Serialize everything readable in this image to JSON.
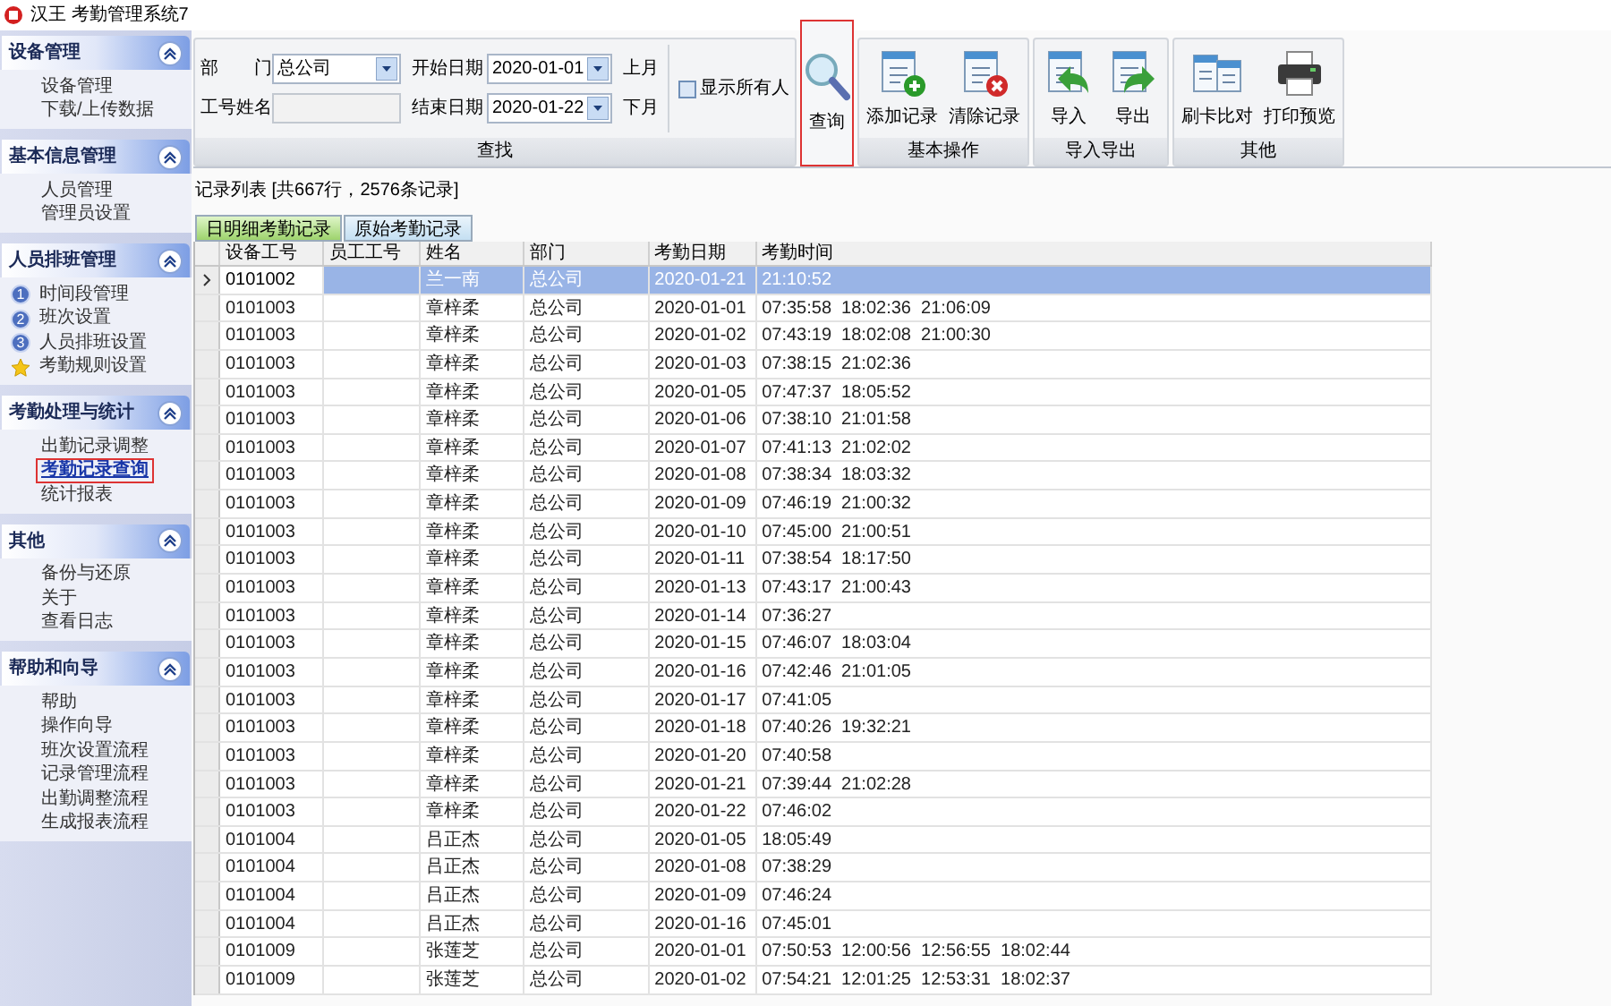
{
  "window": {
    "title": "汉王 考勤管理系统7"
  },
  "sidebar": [
    {
      "title": "设备管理",
      "expanded": true,
      "items": [
        {
          "label": "设备管理",
          "selected": false
        },
        {
          "label": "下载/上传数据",
          "selected": false
        }
      ]
    },
    {
      "title": "基本信息管理",
      "expanded": true,
      "items": [
        {
          "label": "人员管理",
          "selected": false
        },
        {
          "label": "管理员设置",
          "selected": false
        }
      ]
    },
    {
      "title": "人员排班管理",
      "expanded": true,
      "items": [
        {
          "label": "时间段管理",
          "selected": false,
          "kind": "numbered",
          "badge": "1"
        },
        {
          "label": "班次设置",
          "selected": false,
          "kind": "numbered",
          "badge": "2"
        },
        {
          "label": "人员排班设置",
          "selected": false,
          "kind": "numbered",
          "badge": "3"
        },
        {
          "label": "考勤规则设置",
          "selected": false,
          "kind": "star"
        }
      ]
    },
    {
      "title": "考勤处理与统计",
      "expanded": true,
      "items": [
        {
          "label": "出勤记录调整",
          "selected": false
        },
        {
          "label": "考勤记录查询",
          "selected": true
        },
        {
          "label": "统计报表",
          "selected": false
        }
      ]
    },
    {
      "title": "其他",
      "expanded": true,
      "items": [
        {
          "label": "备份与还原",
          "selected": false
        },
        {
          "label": "关于",
          "selected": false
        },
        {
          "label": "查看日志",
          "selected": false
        }
      ]
    },
    {
      "title": "帮助和向导",
      "expanded": true,
      "items": [
        {
          "label": "帮助",
          "selected": false
        },
        {
          "label": "操作向导",
          "selected": false
        },
        {
          "label": "班次设置流程",
          "selected": false
        },
        {
          "label": "记录管理流程",
          "selected": false
        },
        {
          "label": "出勤调整流程",
          "selected": false
        },
        {
          "label": "生成报表流程",
          "selected": false
        }
      ]
    }
  ],
  "filter": {
    "department_label": "部　　门",
    "department": "总公司",
    "id_name_label": "工号姓名",
    "start_label": "开始日期",
    "start_date": "2020-01-01",
    "end_label": "结束日期",
    "end_date": "2020-01-22",
    "prev_month": "上月",
    "next_month": "下月",
    "show_all": {
      "label": "显示所有人",
      "checked": false
    },
    "group_label": "查找"
  },
  "query_button": {
    "label": "查询",
    "highlighted": true
  },
  "toolbar_groups": [
    {
      "label": "基本操作",
      "buttons": [
        {
          "label": "添加记录",
          "kind": "add"
        },
        {
          "label": "清除记录",
          "kind": "delete"
        }
      ]
    },
    {
      "label": "导入导出",
      "buttons": [
        {
          "label": "导入",
          "kind": "import"
        },
        {
          "label": "导出",
          "kind": "export"
        }
      ]
    },
    {
      "label": "其他",
      "buttons": [
        {
          "label": "刷卡比对",
          "kind": "compare"
        },
        {
          "label": "打印预览",
          "kind": "print"
        }
      ]
    }
  ],
  "record_summary": "记录列表 [共667行，2576条记录]",
  "tabs": [
    {
      "label": "日明细考勤记录",
      "selected": true
    },
    {
      "label": "原始考勤记录",
      "selected": false
    }
  ],
  "table": {
    "columns": [
      "设备工号",
      "员工工号",
      "姓名",
      "部门",
      "考勤日期",
      "考勤时间"
    ],
    "rows": [
      {
        "device_id": "0101002",
        "employee_id": "",
        "name": "兰一南",
        "department": "总公司",
        "date": "2020-01-21",
        "times": "21:10:52",
        "selected": true
      },
      {
        "device_id": "0101003",
        "employee_id": "",
        "name": "章梓柔",
        "department": "总公司",
        "date": "2020-01-01",
        "times": "07:35:58  18:02:36  21:06:09",
        "selected": false
      },
      {
        "device_id": "0101003",
        "employee_id": "",
        "name": "章梓柔",
        "department": "总公司",
        "date": "2020-01-02",
        "times": "07:43:19  18:02:08  21:00:30",
        "selected": false
      },
      {
        "device_id": "0101003",
        "employee_id": "",
        "name": "章梓柔",
        "department": "总公司",
        "date": "2020-01-03",
        "times": "07:38:15  21:02:36",
        "selected": false
      },
      {
        "device_id": "0101003",
        "employee_id": "",
        "name": "章梓柔",
        "department": "总公司",
        "date": "2020-01-05",
        "times": "07:47:37  18:05:52",
        "selected": false
      },
      {
        "device_id": "0101003",
        "employee_id": "",
        "name": "章梓柔",
        "department": "总公司",
        "date": "2020-01-06",
        "times": "07:38:10  21:01:58",
        "selected": false
      },
      {
        "device_id": "0101003",
        "employee_id": "",
        "name": "章梓柔",
        "department": "总公司",
        "date": "2020-01-07",
        "times": "07:41:13  21:02:02",
        "selected": false
      },
      {
        "device_id": "0101003",
        "employee_id": "",
        "name": "章梓柔",
        "department": "总公司",
        "date": "2020-01-08",
        "times": "07:38:34  18:03:32",
        "selected": false
      },
      {
        "device_id": "0101003",
        "employee_id": "",
        "name": "章梓柔",
        "department": "总公司",
        "date": "2020-01-09",
        "times": "07:46:19  21:00:32",
        "selected": false
      },
      {
        "device_id": "0101003",
        "employee_id": "",
        "name": "章梓柔",
        "department": "总公司",
        "date": "2020-01-10",
        "times": "07:45:00  21:00:51",
        "selected": false
      },
      {
        "device_id": "0101003",
        "employee_id": "",
        "name": "章梓柔",
        "department": "总公司",
        "date": "2020-01-11",
        "times": "07:38:54  18:17:50",
        "selected": false
      },
      {
        "device_id": "0101003",
        "employee_id": "",
        "name": "章梓柔",
        "department": "总公司",
        "date": "2020-01-13",
        "times": "07:43:17  21:00:43",
        "selected": false
      },
      {
        "device_id": "0101003",
        "employee_id": "",
        "name": "章梓柔",
        "department": "总公司",
        "date": "2020-01-14",
        "times": "07:36:27",
        "selected": false
      },
      {
        "device_id": "0101003",
        "employee_id": "",
        "name": "章梓柔",
        "department": "总公司",
        "date": "2020-01-15",
        "times": "07:46:07  18:03:04",
        "selected": false
      },
      {
        "device_id": "0101003",
        "employee_id": "",
        "name": "章梓柔",
        "department": "总公司",
        "date": "2020-01-16",
        "times": "07:42:46  21:01:05",
        "selected": false
      },
      {
        "device_id": "0101003",
        "employee_id": "",
        "name": "章梓柔",
        "department": "总公司",
        "date": "2020-01-17",
        "times": "07:41:05",
        "selected": false
      },
      {
        "device_id": "0101003",
        "employee_id": "",
        "name": "章梓柔",
        "department": "总公司",
        "date": "2020-01-18",
        "times": "07:40:26  19:32:21",
        "selected": false
      },
      {
        "device_id": "0101003",
        "employee_id": "",
        "name": "章梓柔",
        "department": "总公司",
        "date": "2020-01-20",
        "times": "07:40:58",
        "selected": false
      },
      {
        "device_id": "0101003",
        "employee_id": "",
        "name": "章梓柔",
        "department": "总公司",
        "date": "2020-01-21",
        "times": "07:39:44  21:02:28",
        "selected": false
      },
      {
        "device_id": "0101003",
        "employee_id": "",
        "name": "章梓柔",
        "department": "总公司",
        "date": "2020-01-22",
        "times": "07:46:02",
        "selected": false
      },
      {
        "device_id": "0101004",
        "employee_id": "",
        "name": "吕正杰",
        "department": "总公司",
        "date": "2020-01-05",
        "times": "18:05:49",
        "selected": false
      },
      {
        "device_id": "0101004",
        "employee_id": "",
        "name": "吕正杰",
        "department": "总公司",
        "date": "2020-01-08",
        "times": "07:38:29",
        "selected": false
      },
      {
        "device_id": "0101004",
        "employee_id": "",
        "name": "吕正杰",
        "department": "总公司",
        "date": "2020-01-09",
        "times": "07:46:24",
        "selected": false
      },
      {
        "device_id": "0101004",
        "employee_id": "",
        "name": "吕正杰",
        "department": "总公司",
        "date": "2020-01-16",
        "times": "07:45:01",
        "selected": false
      },
      {
        "device_id": "0101009",
        "employee_id": "",
        "name": "张莲芝",
        "department": "总公司",
        "date": "2020-01-01",
        "times": "07:50:53  12:00:56  12:56:55  18:02:44",
        "selected": false
      },
      {
        "device_id": "0101009",
        "employee_id": "",
        "name": "张莲芝",
        "department": "总公司",
        "date": "2020-01-02",
        "times": "07:54:21  12:01:25  12:53:31  18:02:37",
        "selected": false
      }
    ]
  }
}
